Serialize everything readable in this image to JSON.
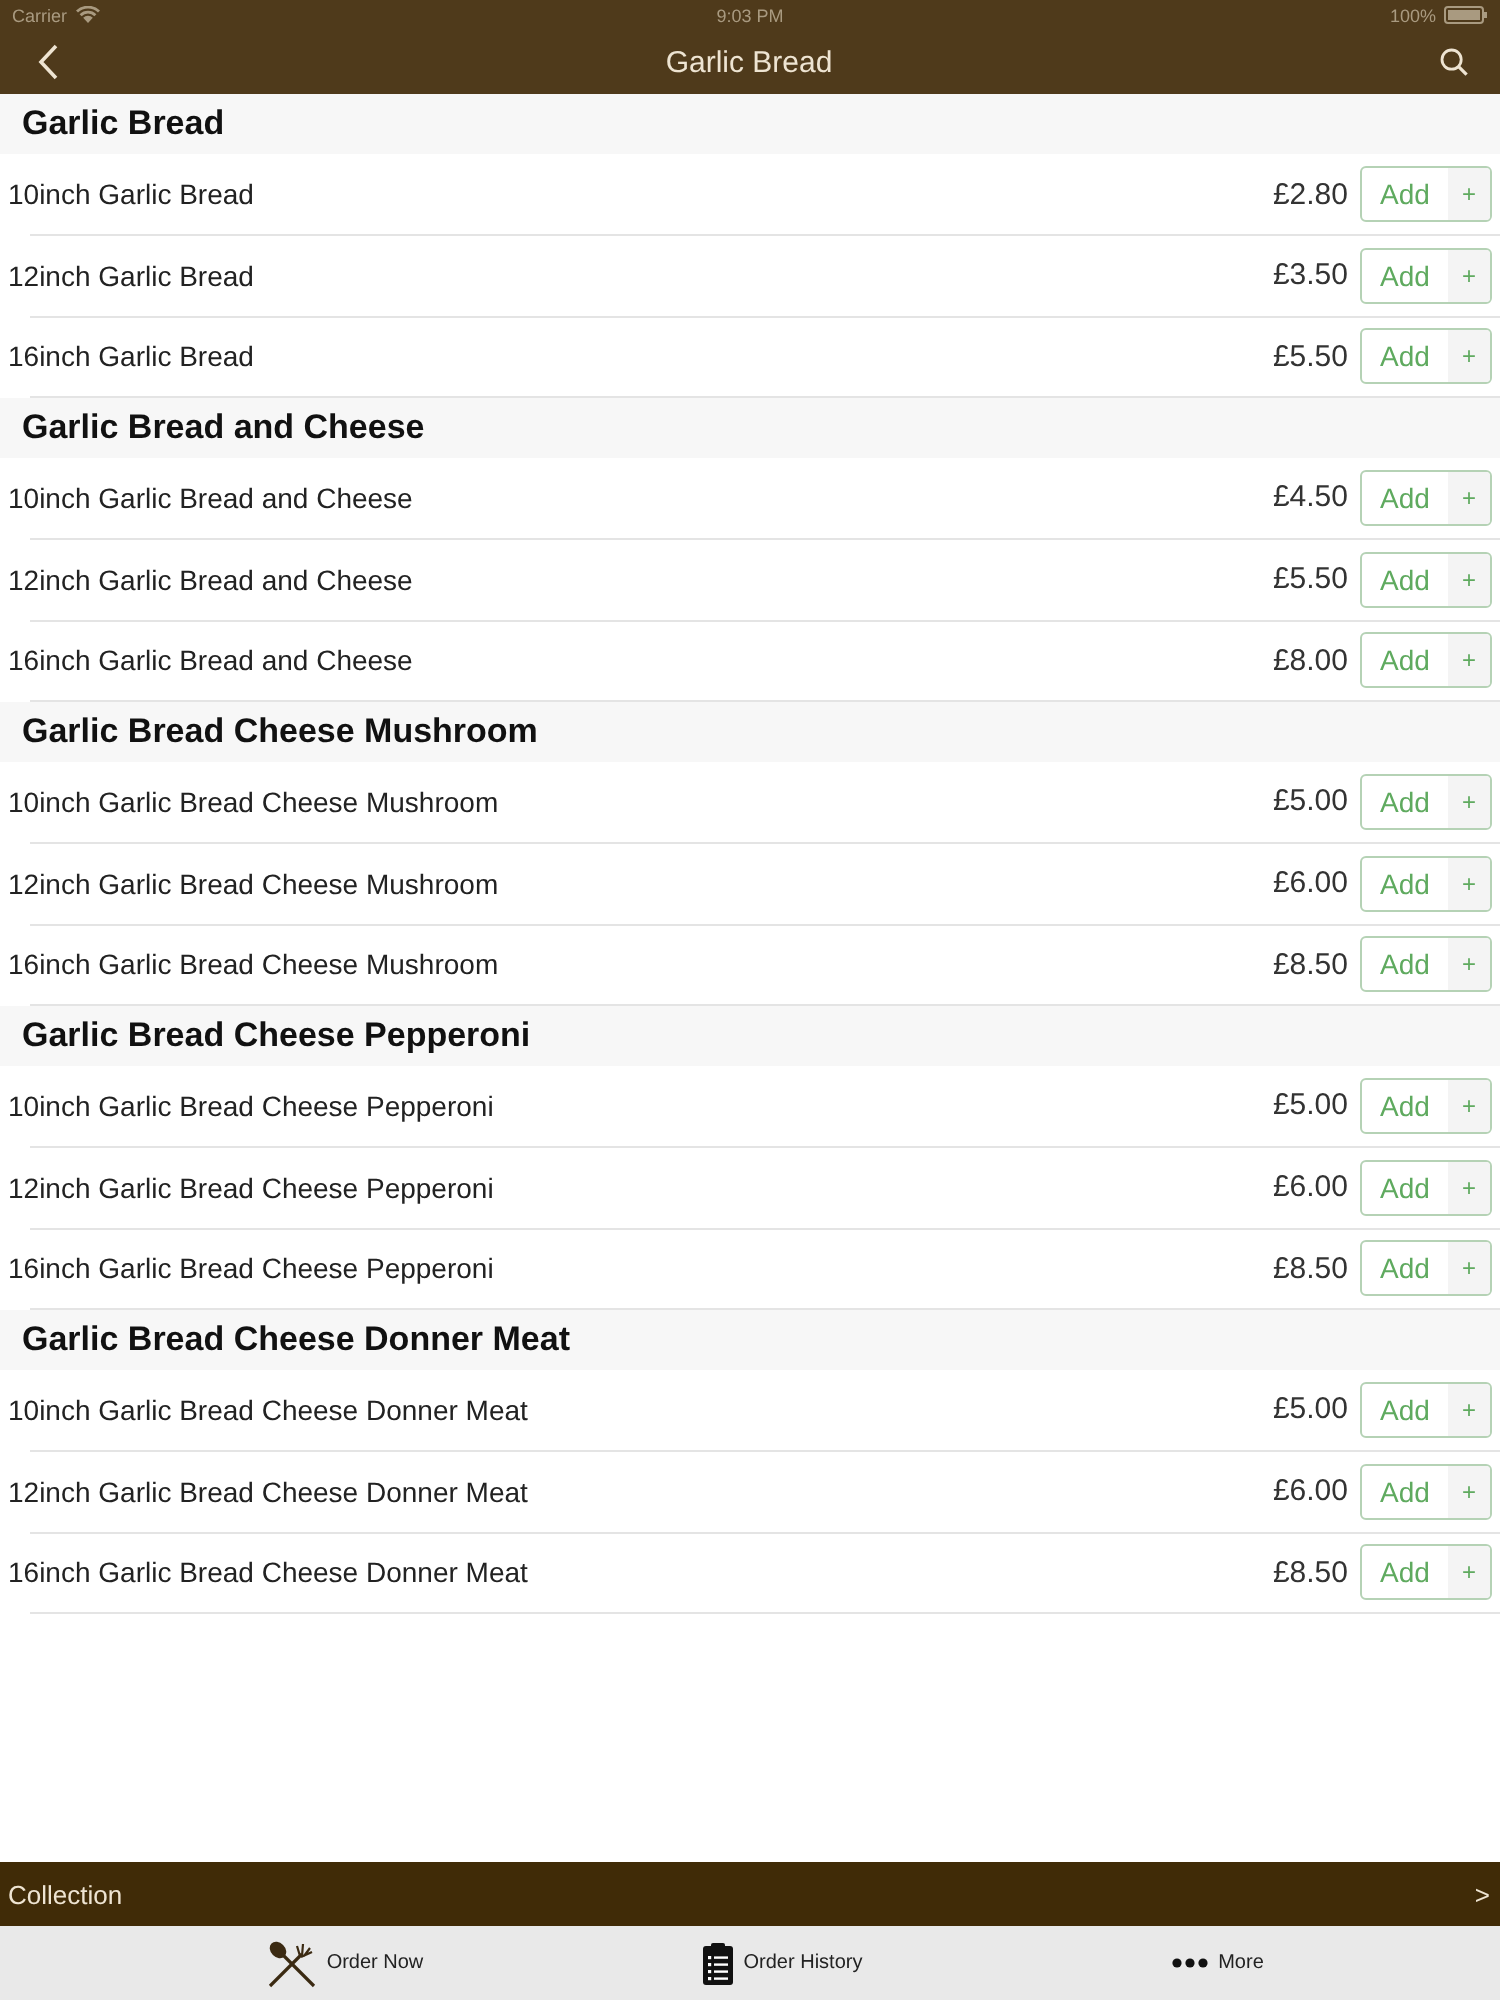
{
  "status_bar": {
    "carrier": "Carrier",
    "time": "9:03 PM",
    "battery": "100%"
  },
  "nav_bar": {
    "title": "Garlic Bread"
  },
  "sections": [
    {
      "title": "Garlic Bread",
      "items": [
        {
          "name": "10inch Garlic Bread",
          "price": "£2.80",
          "button": "Add",
          "button_plus": "+"
        },
        {
          "name": "12inch Garlic Bread",
          "price": "£3.50",
          "button": "Add",
          "button_plus": "+"
        },
        {
          "name": "16inch Garlic Bread",
          "price": "£5.50",
          "button": "Add",
          "button_plus": "+"
        }
      ]
    },
    {
      "title": "Garlic Bread and Cheese",
      "items": [
        {
          "name": "10inch Garlic Bread and Cheese",
          "price": "£4.50",
          "button": "Add",
          "button_plus": "+"
        },
        {
          "name": "12inch Garlic Bread and Cheese",
          "price": "£5.50",
          "button": "Add",
          "button_plus": "+"
        },
        {
          "name": "16inch Garlic Bread and Cheese",
          "price": "£8.00",
          "button": "Add",
          "button_plus": "+"
        }
      ]
    },
    {
      "title": "Garlic Bread Cheese Mushroom",
      "items": [
        {
          "name": "10inch Garlic Bread Cheese Mushroom",
          "price": "£5.00",
          "button": "Add",
          "button_plus": "+"
        },
        {
          "name": "12inch Garlic Bread Cheese Mushroom",
          "price": "£6.00",
          "button": "Add",
          "button_plus": "+"
        },
        {
          "name": "16inch Garlic Bread Cheese Mushroom",
          "price": "£8.50",
          "button": "Add",
          "button_plus": "+"
        }
      ]
    },
    {
      "title": "Garlic Bread Cheese Pepperoni",
      "items": [
        {
          "name": "10inch Garlic Bread Cheese Pepperoni",
          "price": "£5.00",
          "button": "Add",
          "button_plus": "+"
        },
        {
          "name": "12inch Garlic Bread Cheese Pepperoni",
          "price": "£6.00",
          "button": "Add",
          "button_plus": "+"
        },
        {
          "name": "16inch Garlic Bread Cheese Pepperoni",
          "price": "£8.50",
          "button": "Add",
          "button_plus": "+"
        }
      ]
    },
    {
      "title": "Garlic Bread Cheese Donner Meat",
      "items": [
        {
          "name": "10inch Garlic Bread Cheese Donner Meat",
          "price": "£5.00",
          "button": "Add",
          "button_plus": "+"
        },
        {
          "name": "12inch Garlic Bread Cheese Donner Meat",
          "price": "£6.00",
          "button": "Add",
          "button_plus": "+"
        },
        {
          "name": "16inch Garlic Bread Cheese Donner Meat",
          "price": "£8.50",
          "button": "Add",
          "button_plus": "+"
        }
      ]
    }
  ],
  "collection_bar": {
    "label": "Collection",
    "chevron": ">"
  },
  "tab_bar": [
    {
      "kind": "cutlery",
      "label": "Order Now"
    },
    {
      "kind": "clipboard",
      "label": "Order History"
    },
    {
      "kind": "dots",
      "label": "More"
    }
  ]
}
